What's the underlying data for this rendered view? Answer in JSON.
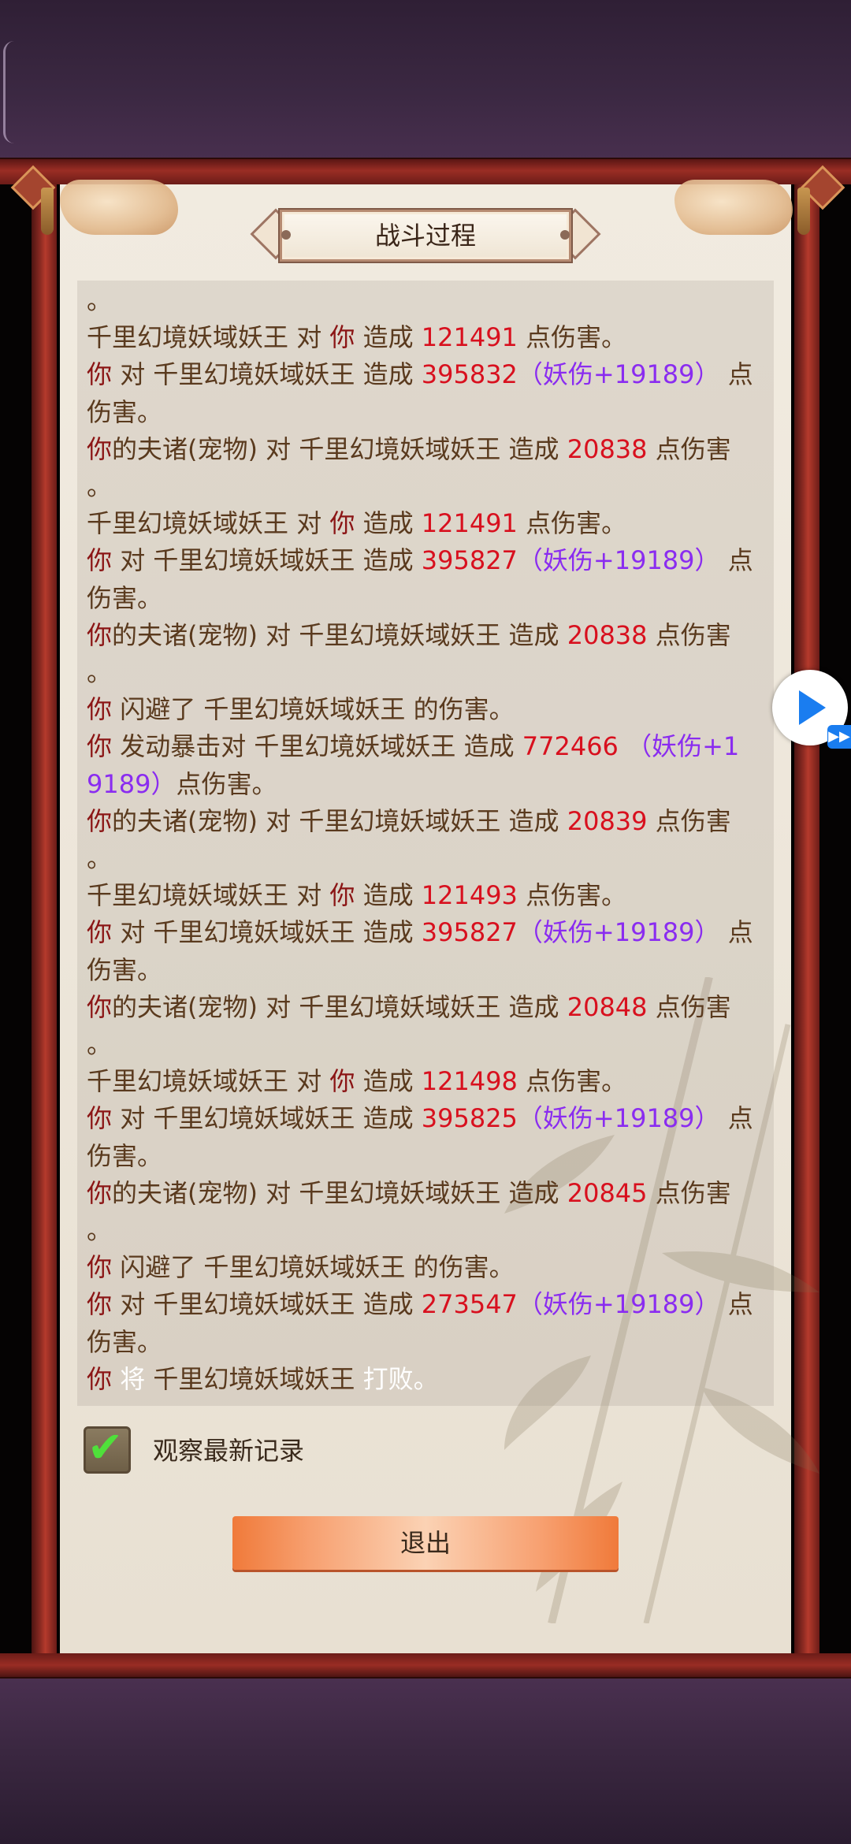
{
  "title": "战斗过程",
  "log": [
    [
      [
        "text",
        "。"
      ]
    ],
    [
      [
        "enemy",
        "千里幻境妖域妖王"
      ],
      [
        "text",
        " 对 "
      ],
      [
        "name",
        "你"
      ],
      [
        "text",
        " 造成 "
      ],
      [
        "num",
        "121491"
      ],
      [
        "text",
        " 点伤害。"
      ]
    ],
    [
      [
        "name",
        "你"
      ],
      [
        "text",
        " 对 "
      ],
      [
        "enemy",
        "千里幻境妖域妖王"
      ],
      [
        "text",
        " 造成 "
      ],
      [
        "num",
        "395832"
      ],
      [
        "bonus",
        "（妖伤+19189）"
      ],
      [
        "text",
        " 点"
      ]
    ],
    [
      [
        "text",
        "伤害。"
      ]
    ],
    [
      [
        "name",
        "你"
      ],
      [
        "text",
        "的夫诸(宠物) 对 "
      ],
      [
        "enemy",
        "千里幻境妖域妖王"
      ],
      [
        "text",
        " 造成 "
      ],
      [
        "num",
        "20838"
      ],
      [
        "text",
        " 点伤害"
      ]
    ],
    [
      [
        "text",
        "。"
      ]
    ],
    [
      [
        "enemy",
        "千里幻境妖域妖王"
      ],
      [
        "text",
        " 对 "
      ],
      [
        "name",
        "你"
      ],
      [
        "text",
        " 造成 "
      ],
      [
        "num",
        "121491"
      ],
      [
        "text",
        " 点伤害。"
      ]
    ],
    [
      [
        "name",
        "你"
      ],
      [
        "text",
        " 对 "
      ],
      [
        "enemy",
        "千里幻境妖域妖王"
      ],
      [
        "text",
        " 造成 "
      ],
      [
        "num",
        "395827"
      ],
      [
        "bonus",
        "（妖伤+19189）"
      ],
      [
        "text",
        " 点"
      ]
    ],
    [
      [
        "text",
        "伤害。"
      ]
    ],
    [
      [
        "name",
        "你"
      ],
      [
        "text",
        "的夫诸(宠物) 对 "
      ],
      [
        "enemy",
        "千里幻境妖域妖王"
      ],
      [
        "text",
        " 造成 "
      ],
      [
        "num",
        "20838"
      ],
      [
        "text",
        " 点伤害"
      ]
    ],
    [
      [
        "text",
        "。"
      ]
    ],
    [
      [
        "name",
        "你"
      ],
      [
        "text",
        " 闪避了 "
      ],
      [
        "enemy",
        "千里幻境妖域妖王"
      ],
      [
        "text",
        " 的伤害。"
      ]
    ],
    [
      [
        "name",
        "你"
      ],
      [
        "text",
        " 发动暴击对 "
      ],
      [
        "enemy",
        "千里幻境妖域妖王"
      ],
      [
        "text",
        " 造成 "
      ],
      [
        "num",
        "772466"
      ],
      [
        "bonus",
        " （妖伤+1"
      ]
    ],
    [
      [
        "bonus",
        "9189）"
      ],
      [
        "text",
        "点伤害。"
      ]
    ],
    [
      [
        "name",
        "你"
      ],
      [
        "text",
        "的夫诸(宠物) 对 "
      ],
      [
        "enemy",
        "千里幻境妖域妖王"
      ],
      [
        "text",
        " 造成 "
      ],
      [
        "num",
        "20839"
      ],
      [
        "text",
        " 点伤害"
      ]
    ],
    [
      [
        "text",
        "。"
      ]
    ],
    [
      [
        "enemy",
        "千里幻境妖域妖王"
      ],
      [
        "text",
        " 对 "
      ],
      [
        "name",
        "你"
      ],
      [
        "text",
        " 造成 "
      ],
      [
        "num",
        "121493"
      ],
      [
        "text",
        " 点伤害。"
      ]
    ],
    [
      [
        "name",
        "你"
      ],
      [
        "text",
        " 对 "
      ],
      [
        "enemy",
        "千里幻境妖域妖王"
      ],
      [
        "text",
        " 造成 "
      ],
      [
        "num",
        "395827"
      ],
      [
        "bonus",
        "（妖伤+19189）"
      ],
      [
        "text",
        " 点"
      ]
    ],
    [
      [
        "text",
        "伤害。"
      ]
    ],
    [
      [
        "name",
        "你"
      ],
      [
        "text",
        "的夫诸(宠物) 对 "
      ],
      [
        "enemy",
        "千里幻境妖域妖王"
      ],
      [
        "text",
        " 造成 "
      ],
      [
        "num",
        "20848"
      ],
      [
        "text",
        " 点伤害"
      ]
    ],
    [
      [
        "text",
        "。"
      ]
    ],
    [
      [
        "enemy",
        "千里幻境妖域妖王"
      ],
      [
        "text",
        " 对 "
      ],
      [
        "name",
        "你"
      ],
      [
        "text",
        " 造成 "
      ],
      [
        "num",
        "121498"
      ],
      [
        "text",
        " 点伤害。"
      ]
    ],
    [
      [
        "name",
        "你"
      ],
      [
        "text",
        " 对 "
      ],
      [
        "enemy",
        "千里幻境妖域妖王"
      ],
      [
        "text",
        " 造成 "
      ],
      [
        "num",
        "395825"
      ],
      [
        "bonus",
        "（妖伤+19189）"
      ],
      [
        "text",
        " 点"
      ]
    ],
    [
      [
        "text",
        "伤害。"
      ]
    ],
    [
      [
        "name",
        "你"
      ],
      [
        "text",
        "的夫诸(宠物) 对 "
      ],
      [
        "enemy",
        "千里幻境妖域妖王"
      ],
      [
        "text",
        " 造成 "
      ],
      [
        "num",
        "20845"
      ],
      [
        "text",
        " 点伤害"
      ]
    ],
    [
      [
        "text",
        "。"
      ]
    ],
    [
      [
        "name",
        "你"
      ],
      [
        "text",
        " 闪避了 "
      ],
      [
        "enemy",
        "千里幻境妖域妖王"
      ],
      [
        "text",
        " 的伤害。"
      ]
    ],
    [
      [
        "name",
        "你"
      ],
      [
        "text",
        " 对 "
      ],
      [
        "enemy",
        "千里幻境妖域妖王"
      ],
      [
        "text",
        " 造成 "
      ],
      [
        "num",
        "273547"
      ],
      [
        "bonus",
        "（妖伤+19189）"
      ],
      [
        "text",
        " 点"
      ]
    ],
    [
      [
        "text",
        "伤害。"
      ]
    ],
    [
      [
        "name",
        "你"
      ],
      [
        "white",
        " 将 "
      ],
      [
        "enemy",
        "千里幻境妖域妖王"
      ],
      [
        "white",
        " 打败。"
      ]
    ]
  ],
  "watch_latest": {
    "label": "观察最新记录",
    "checked": true,
    "check_glyph": "✔"
  },
  "exit_label": "退出",
  "colors": {
    "name": "#8b1515",
    "enemy": "#5a3a1e",
    "text": "#5a3a1e",
    "num": "#d8101e",
    "bonus": "#8a2cf0",
    "white": "#ffffff"
  },
  "icons": {
    "play": "play-icon",
    "fast_forward": "fast-forward-icon",
    "check": "checkmark-icon"
  },
  "overlay_glyph": "▶▶"
}
